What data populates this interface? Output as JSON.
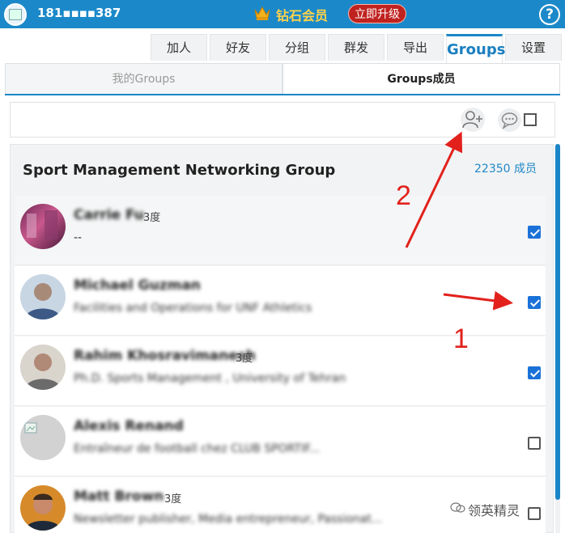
{
  "header": {
    "phone": "181▪▪▪▪387",
    "vip_label": "钻石会员",
    "upgrade_label": "立即升级",
    "help_label": "?"
  },
  "main_tabs": [
    "加人",
    "好友",
    "分组",
    "群发",
    "导出",
    "Groups",
    "设置"
  ],
  "sub_tabs": [
    "我的Groups",
    "Groups成员"
  ],
  "group": {
    "title": "Sport Management Networking Group",
    "member_count": "22350 成员"
  },
  "members": [
    {
      "name": "Carrie Fu",
      "degree": "3度",
      "subtitle": "--",
      "checked": true
    },
    {
      "name": "Michael Guzman",
      "degree": "",
      "subtitle": "Facilities and Operations for UNF Athletics",
      "checked": true
    },
    {
      "name": "Rahim Khosravimanesh",
      "degree": "3度",
      "subtitle": "Ph.D. Sports Management , University of Tehran",
      "checked": true
    },
    {
      "name": "Alexis Renand",
      "degree": "",
      "subtitle": "Entraîneur de football chez CLUB SPORTIF...",
      "checked": false
    },
    {
      "name": "Matt Brown",
      "degree": "3度",
      "subtitle": "Newsletter publisher, Media entrepreneur, Passionat...",
      "checked": false
    }
  ],
  "annotations": {
    "one": "1",
    "two": "2"
  },
  "watermark": "领英精灵",
  "colors": {
    "primary": "#1b89c9",
    "accent": "#1a72d8",
    "upgrade": "#c0231f",
    "annotation": "#e2211c"
  }
}
